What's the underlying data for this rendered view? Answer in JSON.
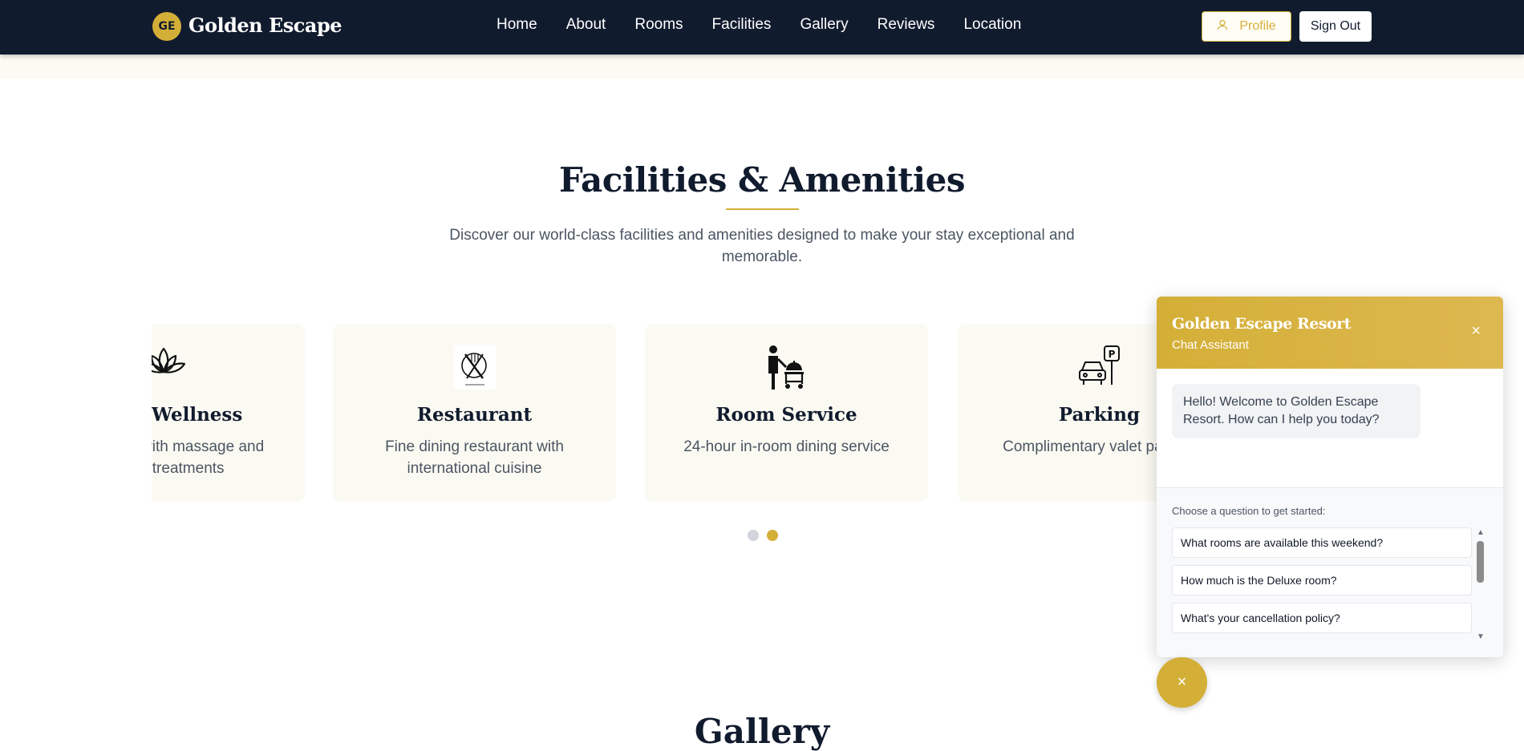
{
  "brand": {
    "badge": "GE",
    "name": "Golden Escape"
  },
  "nav": [
    "Home",
    "About",
    "Rooms",
    "Facilities",
    "Gallery",
    "Reviews",
    "Location"
  ],
  "header_actions": {
    "profile": "Profile",
    "sign_out": "Sign Out"
  },
  "section": {
    "title": "Facilities & Amenities",
    "subtitle": "Discover our world-class facilities and amenities designed to make your stay exceptional and memorable."
  },
  "cards": [
    {
      "icon": "lotus-icon",
      "title": "Spa & Wellness",
      "desc": "Luxury spa with massage and beauty treatments"
    },
    {
      "icon": "restaurant-icon",
      "title": "Restaurant",
      "desc": "Fine dining restaurant with international cuisine"
    },
    {
      "icon": "room-service-icon",
      "title": "Room Service",
      "desc": "24-hour in-room dining service"
    },
    {
      "icon": "parking-icon",
      "title": "Parking",
      "desc": "Complimentary valet parking"
    }
  ],
  "carousel": {
    "pages": 2,
    "active_page": 2
  },
  "next_section_title": "Gallery",
  "chat": {
    "title": "Golden Escape Resort",
    "subtitle": "Chat Assistant",
    "greeting": "Hello! Welcome to Golden Escape Resort. How can I help you today?",
    "prompt": "Choose a question to get started:",
    "questions": [
      "What rooms are available this weekend?",
      "How much is the Deluxe room?",
      "What's your cancellation policy?"
    ]
  },
  "colors": {
    "navy": "#111b2e",
    "gold": "#d4af37"
  }
}
